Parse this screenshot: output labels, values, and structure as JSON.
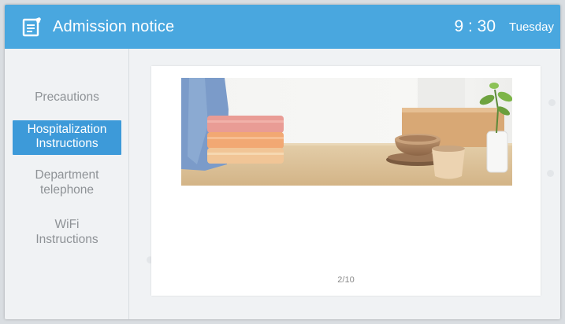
{
  "header": {
    "title": "Admission notice",
    "icon": "edit-document-icon",
    "time": "9 : 30",
    "day": "Tuesday",
    "background_color": "#49a7df"
  },
  "sidebar": {
    "items": [
      {
        "label": "Precautions",
        "active": false
      },
      {
        "label": "Hospitalization Instructions",
        "active": true
      },
      {
        "label": "Department telephone",
        "active": false
      },
      {
        "label": "WiFi Instructions",
        "active": false
      }
    ],
    "active_color": "#3d9ad9"
  },
  "main": {
    "banner_image": "towels-and-tableware-photo",
    "page_indicator": "2/10"
  }
}
